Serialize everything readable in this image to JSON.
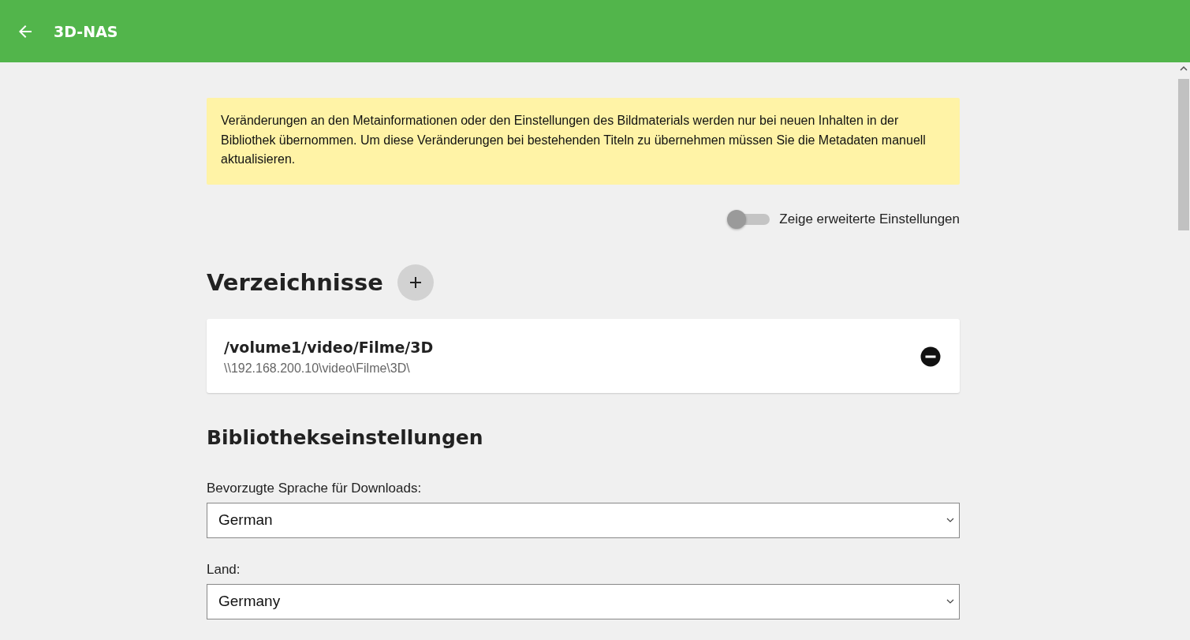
{
  "header": {
    "title": "3D-NAS"
  },
  "notice": "Veränderungen an den Metainformationen oder den Einstellungen des Bildmaterials werden nur bei neuen Inhalten in der Bibliothek übernommen. Um diese Veränderungen bei bestehenden Titeln zu übernehmen müssen Sie die Metadaten manuell aktualisieren.",
  "advanced_toggle": {
    "label": "Zeige erweiterte Einstellungen",
    "on": false
  },
  "folders": {
    "title": "Verzeichnisse",
    "items": [
      {
        "path": "/volume1/video/Filme/3D",
        "network_path": "\\\\192.168.200.10\\video\\Filme\\3D\\"
      }
    ]
  },
  "library_settings": {
    "title": "Bibliothekseinstellungen",
    "fields": [
      {
        "label": "Bevorzugte Sprache für Downloads:",
        "value": "German"
      },
      {
        "label": "Land:",
        "value": "Germany"
      }
    ]
  }
}
